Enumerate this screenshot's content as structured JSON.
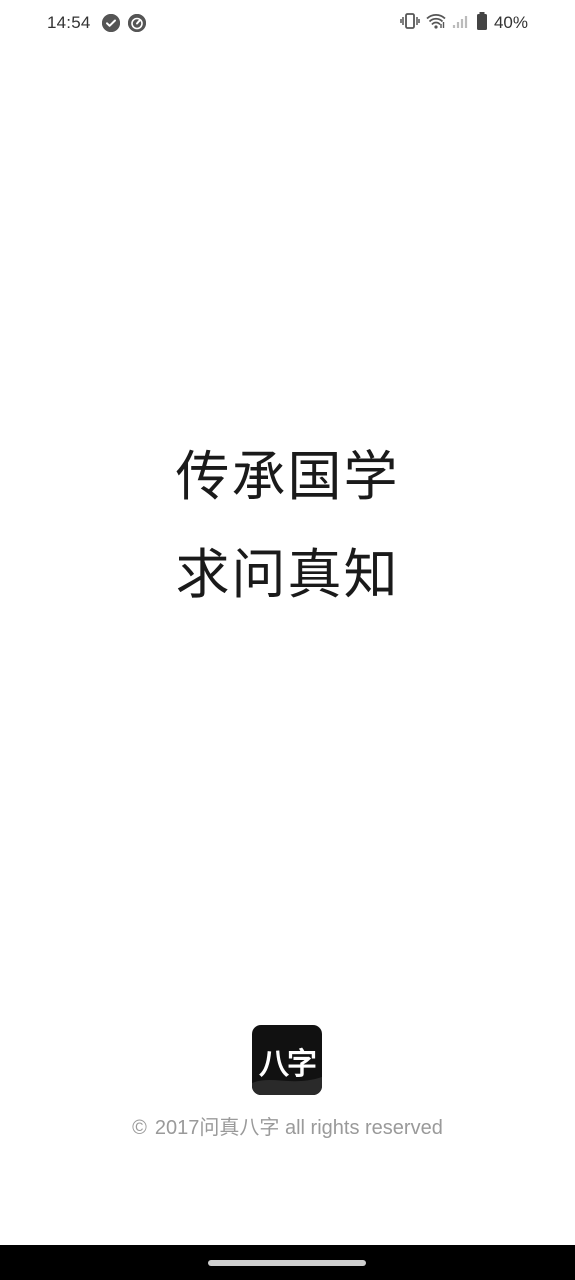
{
  "status_bar": {
    "time": "14:54",
    "battery_percent": "40%",
    "notification_icons": [
      "check-circle-icon",
      "speedometer-icon"
    ],
    "system_icons": [
      "vibrate-icon",
      "wifi-icon",
      "signal-icon",
      "battery-icon"
    ]
  },
  "splash": {
    "slogan_line1": "传承国学",
    "slogan_line2": "求问真知"
  },
  "logo": {
    "text": "八字",
    "background": "#111111"
  },
  "footer": {
    "copyright_symbol": "©",
    "copyright_text": "2017问真八字 all rights reserved"
  }
}
